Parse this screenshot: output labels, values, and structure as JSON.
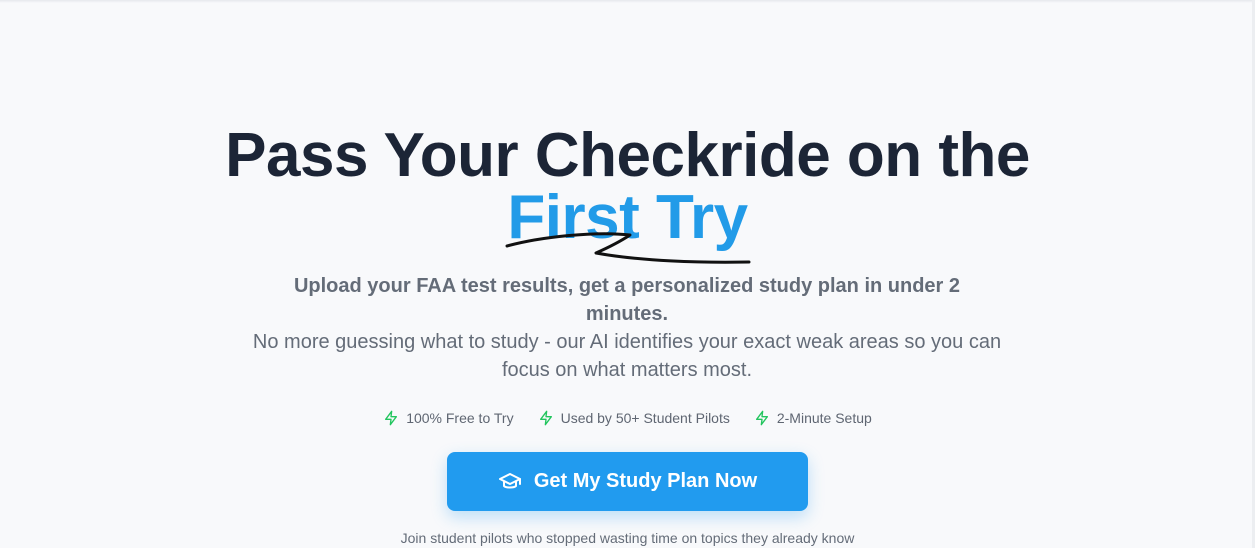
{
  "hero": {
    "headline_main": "Pass Your Checkride on the",
    "headline_accent": "First Try",
    "subhead_strong": "Upload your FAA test results, get a personalized study plan in under 2 minutes.",
    "subhead_light": "No more guessing what to study - our AI identifies your exact weak areas so you can focus on what matters most.",
    "features": [
      {
        "icon": "lightning-bolt-icon",
        "label": "100% Free to Try"
      },
      {
        "icon": "lightning-bolt-icon",
        "label": "Used by 50+ Student Pilots"
      },
      {
        "icon": "lightning-bolt-icon",
        "label": "2-Minute Setup"
      }
    ],
    "cta": {
      "icon": "graduation-cap-icon",
      "label": "Get My Study Plan Now"
    },
    "footnote": "Join student pilots who stopped wasting time on topics they already know"
  },
  "colors": {
    "background": "#f8f9fb",
    "headline": "#1c2536",
    "accent": "#229be8",
    "body_text": "#646c78",
    "feature_icon": "#22c55e",
    "cta_background": "#219bef",
    "cta_text": "#ffffff"
  }
}
